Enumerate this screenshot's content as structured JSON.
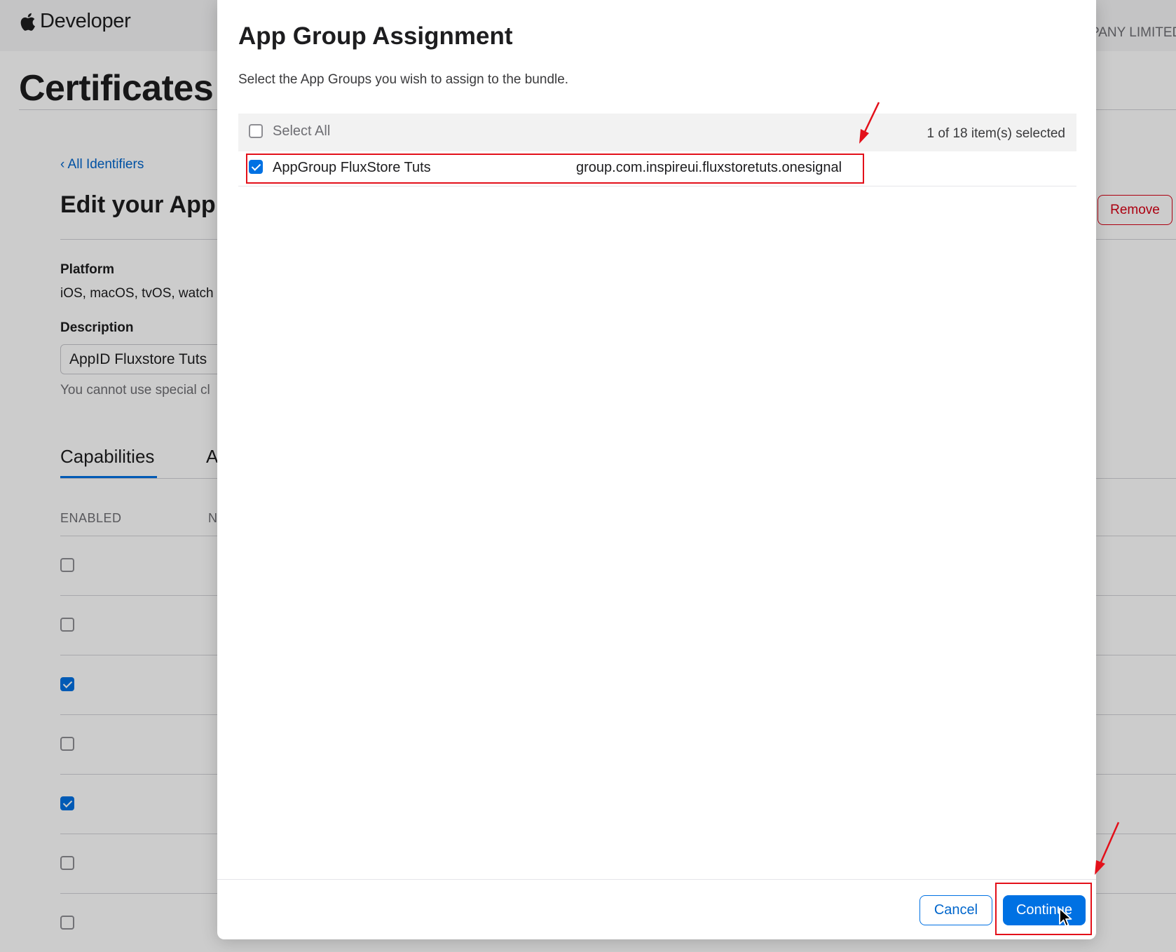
{
  "header": {
    "brand": "Developer",
    "company_fragment": "PANY LIMITED"
  },
  "page": {
    "title": "Certificates",
    "back_link": "‹ All Identifiers",
    "edit_heading": "Edit your App",
    "remove_label": "Remove",
    "platform_label": "Platform",
    "platform_value": "iOS, macOS, tvOS, watch",
    "description_label": "Description",
    "description_value": "AppID Fluxstore Tuts",
    "hint": "You cannot use special cl",
    "tabs": [
      {
        "label": "Capabilities",
        "active": true
      },
      {
        "label": "A",
        "active": false
      }
    ],
    "columns": {
      "enabled": "ENABLED",
      "name": "N"
    },
    "capability_rows": [
      {
        "enabled": false
      },
      {
        "enabled": false
      },
      {
        "enabled": true
      },
      {
        "enabled": false
      },
      {
        "enabled": true
      },
      {
        "enabled": false
      },
      {
        "enabled": false
      }
    ]
  },
  "modal": {
    "title": "App Group Assignment",
    "description": "Select the App Groups you wish to assign to the bundle.",
    "select_all_label": "Select All",
    "select_all_checked": false,
    "count_text": "1 of 18 item(s) selected",
    "groups": [
      {
        "name": "AppGroup FluxStore Tuts",
        "identifier": "group.com.inspireui.fluxstoretuts.onesignal",
        "checked": true
      }
    ],
    "cancel_label": "Cancel",
    "continue_label": "Continue"
  },
  "colors": {
    "accent": "#0071e3",
    "destructive": "#d70015",
    "annotation": "#e3101a"
  }
}
